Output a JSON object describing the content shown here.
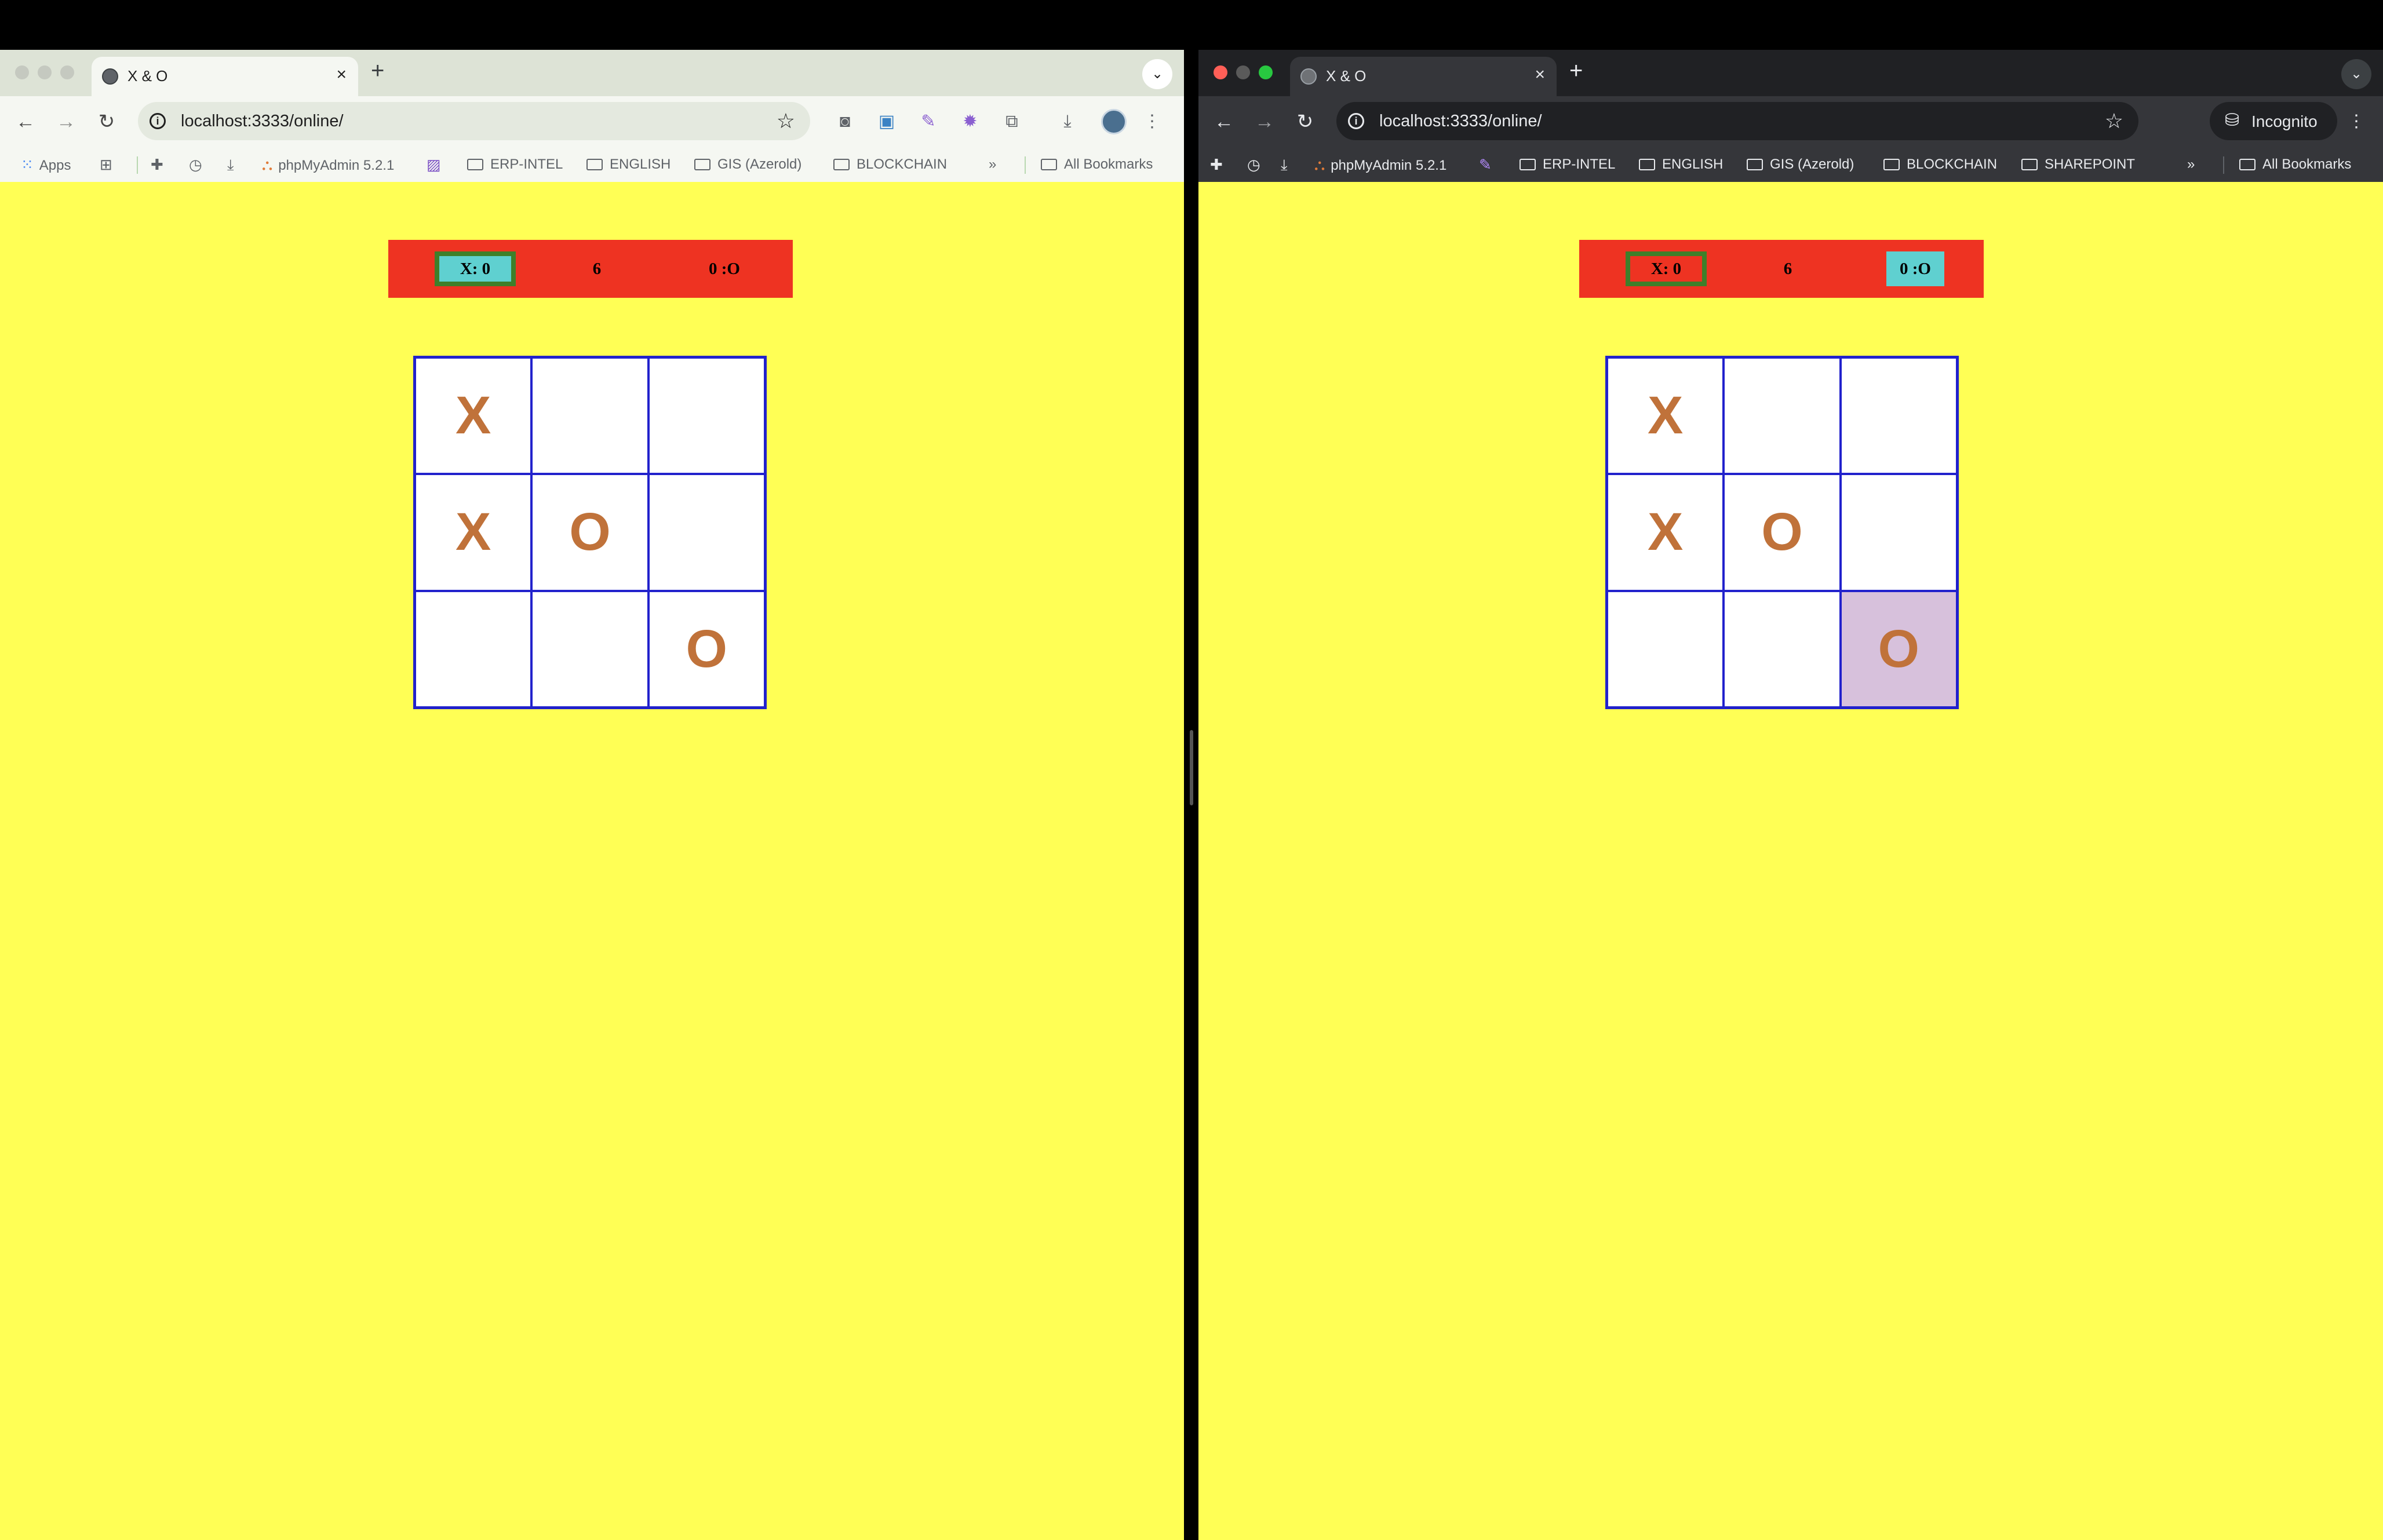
{
  "windows": [
    {
      "id": "normal",
      "tab_title": "X & O",
      "url": "localhost:3333/online/",
      "bookmarks": [
        "Apps",
        "phpMyAdmin 5.2.1",
        "ERP-INTEL",
        "ENGLISH",
        "GIS (Azerold)",
        "BLOCKCHAIN",
        "All Bookmarks"
      ],
      "score": {
        "x": "X: 0",
        "moves": "6",
        "o": "0 :O"
      },
      "active_player": "x",
      "board": [
        "X",
        "",
        "",
        "X",
        "O",
        "",
        "",
        "",
        "O"
      ],
      "highlighted_cell": null
    },
    {
      "id": "incognito",
      "tab_title": "X & O",
      "url": "localhost:3333/online/",
      "incognito_label": "Incognito",
      "bookmarks": [
        "phpMyAdmin 5.2.1",
        "ERP-INTEL",
        "ENGLISH",
        "GIS (Azerold)",
        "BLOCKCHAIN",
        "SHAREPOINT",
        "All Bookmarks"
      ],
      "score": {
        "x": "X: 0",
        "moves": "6",
        "o": "0 :O"
      },
      "active_player": "o",
      "board": [
        "X",
        "",
        "",
        "X",
        "O",
        "",
        "",
        "",
        "O"
      ],
      "highlighted_cell": 8
    }
  ],
  "colors": {
    "page_background": "#ffff55",
    "score_bar": "#ee3322",
    "active_player": "#5fd0d0",
    "player_border": "#3f7f2a",
    "grid_lines": "#2222cc",
    "mark": "#c0723a",
    "highlight": "#d7c1dc"
  }
}
